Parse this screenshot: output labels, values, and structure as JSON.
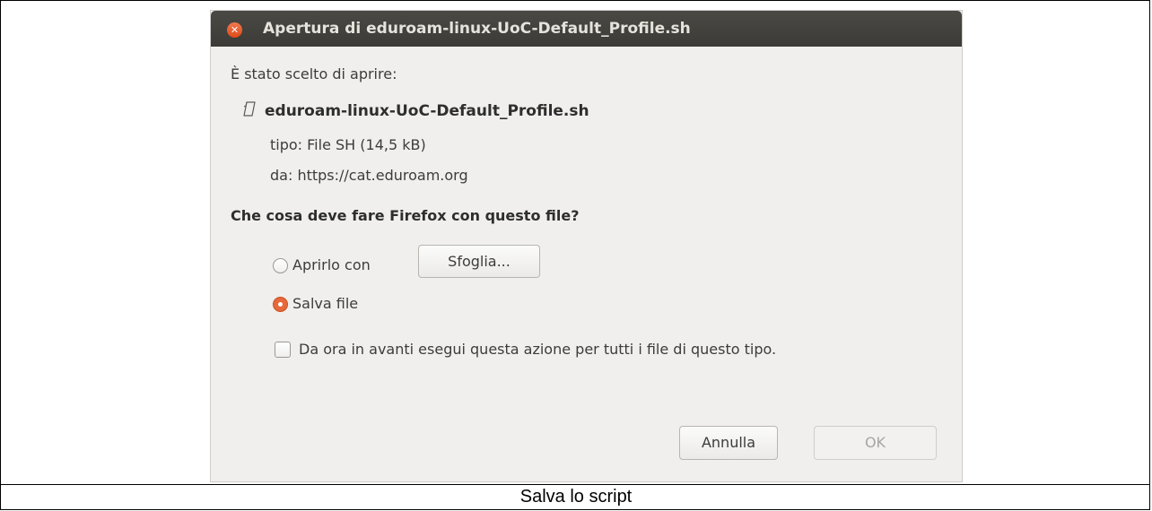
{
  "dialog": {
    "title": "Apertura di eduroam-linux-UoC-Default_Profile.sh",
    "intro": "È stato scelto di aprire:",
    "file_name": "eduroam-linux-UoC-Default_Profile.sh",
    "file_type": "tipo: File SH (14,5 kB)",
    "file_from": "da: https://cat.eduroam.org",
    "question": "Che cosa deve fare Firefox con questo file?",
    "open_with_label": "Aprirlo con",
    "browse_button": "Sfoglia...",
    "save_file_label": "Salva file",
    "selected_option": "save_file",
    "always_label": "Da ora in avanti esegui questa azione per tutti i file di questo tipo.",
    "always_checked": false,
    "cancel_button": "Annulla",
    "ok_button": "OK",
    "ok_enabled": false
  },
  "caption": "Salva lo script",
  "colors": {
    "titlebar": "#3c3b37",
    "close_button": "#df4a16",
    "radio_selected": "#e7683a",
    "dialog_background": "#f0efee"
  },
  "icons": {
    "close": "close-icon",
    "file": "file-icon"
  }
}
